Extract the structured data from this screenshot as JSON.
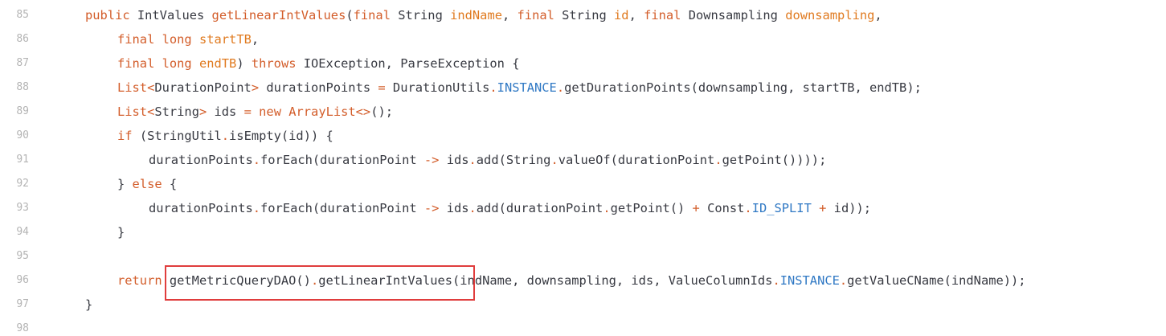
{
  "lines": [
    {
      "num": "85",
      "tokens": [
        {
          "t": "public",
          "c": "kw"
        },
        {
          "t": " IntValues ",
          "c": "tp"
        },
        {
          "t": "getLinearIntValues",
          "c": "fn"
        },
        {
          "t": "(",
          "c": "tp"
        },
        {
          "t": "final",
          "c": "kw"
        },
        {
          "t": " String ",
          "c": "tp"
        },
        {
          "t": "indName",
          "c": "pm"
        },
        {
          "t": ", ",
          "c": "tp"
        },
        {
          "t": "final",
          "c": "kw"
        },
        {
          "t": " String ",
          "c": "tp"
        },
        {
          "t": "id",
          "c": "pm"
        },
        {
          "t": ", ",
          "c": "tp"
        },
        {
          "t": "final",
          "c": "kw"
        },
        {
          "t": " Downsampling ",
          "c": "tp"
        },
        {
          "t": "downsampling",
          "c": "pm"
        },
        {
          "t": ",",
          "c": "tp"
        }
      ],
      "indent": 1
    },
    {
      "num": "86",
      "tokens": [
        {
          "t": "final",
          "c": "kw"
        },
        {
          "t": " ",
          "c": "tp"
        },
        {
          "t": "long",
          "c": "kw"
        },
        {
          "t": " ",
          "c": "tp"
        },
        {
          "t": "startTB",
          "c": "pm"
        },
        {
          "t": ",",
          "c": "tp"
        }
      ],
      "indent": 2
    },
    {
      "num": "87",
      "tokens": [
        {
          "t": "final",
          "c": "kw"
        },
        {
          "t": " ",
          "c": "tp"
        },
        {
          "t": "long",
          "c": "kw"
        },
        {
          "t": " ",
          "c": "tp"
        },
        {
          "t": "endTB",
          "c": "pm"
        },
        {
          "t": ") ",
          "c": "tp"
        },
        {
          "t": "throws",
          "c": "kw"
        },
        {
          "t": " IOException, ParseException {",
          "c": "tp"
        }
      ],
      "indent": 2
    },
    {
      "num": "88",
      "tokens": [
        {
          "t": "List",
          "c": "kw"
        },
        {
          "t": "<",
          "c": "op"
        },
        {
          "t": "DurationPoint",
          "c": "tp"
        },
        {
          "t": ">",
          "c": "op"
        },
        {
          "t": " durationPoints ",
          "c": "tp"
        },
        {
          "t": "=",
          "c": "op"
        },
        {
          "t": " DurationUtils",
          "c": "tp"
        },
        {
          "t": ".",
          "c": "op"
        },
        {
          "t": "INSTANCE",
          "c": "cn"
        },
        {
          "t": ".",
          "c": "op"
        },
        {
          "t": "getDurationPoints(downsampling, startTB, endTB);",
          "c": "tp"
        }
      ],
      "indent": 2
    },
    {
      "num": "89",
      "tokens": [
        {
          "t": "List",
          "c": "kw"
        },
        {
          "t": "<",
          "c": "op"
        },
        {
          "t": "String",
          "c": "tp"
        },
        {
          "t": ">",
          "c": "op"
        },
        {
          "t": " ids ",
          "c": "tp"
        },
        {
          "t": "=",
          "c": "op"
        },
        {
          "t": " ",
          "c": "tp"
        },
        {
          "t": "new",
          "c": "kw"
        },
        {
          "t": " ",
          "c": "tp"
        },
        {
          "t": "ArrayList",
          "c": "kw"
        },
        {
          "t": "<>",
          "c": "op"
        },
        {
          "t": "();",
          "c": "tp"
        }
      ],
      "indent": 2
    },
    {
      "num": "90",
      "tokens": [
        {
          "t": "if",
          "c": "kw"
        },
        {
          "t": " (StringUtil",
          "c": "tp"
        },
        {
          "t": ".",
          "c": "op"
        },
        {
          "t": "isEmpty(id)) {",
          "c": "tp"
        }
      ],
      "indent": 2
    },
    {
      "num": "91",
      "tokens": [
        {
          "t": "durationPoints",
          "c": "tp"
        },
        {
          "t": ".",
          "c": "op"
        },
        {
          "t": "forEach(durationPoint ",
          "c": "tp"
        },
        {
          "t": "->",
          "c": "op"
        },
        {
          "t": " ids",
          "c": "tp"
        },
        {
          "t": ".",
          "c": "op"
        },
        {
          "t": "add(String",
          "c": "tp"
        },
        {
          "t": ".",
          "c": "op"
        },
        {
          "t": "valueOf(durationPoint",
          "c": "tp"
        },
        {
          "t": ".",
          "c": "op"
        },
        {
          "t": "getPoint())));",
          "c": "tp"
        }
      ],
      "indent": 3
    },
    {
      "num": "92",
      "tokens": [
        {
          "t": "} ",
          "c": "tp"
        },
        {
          "t": "else",
          "c": "kw"
        },
        {
          "t": " {",
          "c": "tp"
        }
      ],
      "indent": 2
    },
    {
      "num": "93",
      "tokens": [
        {
          "t": "durationPoints",
          "c": "tp"
        },
        {
          "t": ".",
          "c": "op"
        },
        {
          "t": "forEach(durationPoint ",
          "c": "tp"
        },
        {
          "t": "->",
          "c": "op"
        },
        {
          "t": " ids",
          "c": "tp"
        },
        {
          "t": ".",
          "c": "op"
        },
        {
          "t": "add(durationPoint",
          "c": "tp"
        },
        {
          "t": ".",
          "c": "op"
        },
        {
          "t": "getPoint() ",
          "c": "tp"
        },
        {
          "t": "+",
          "c": "op"
        },
        {
          "t": " Const",
          "c": "tp"
        },
        {
          "t": ".",
          "c": "op"
        },
        {
          "t": "ID_SPLIT",
          "c": "cn"
        },
        {
          "t": " ",
          "c": "tp"
        },
        {
          "t": "+",
          "c": "op"
        },
        {
          "t": " id));",
          "c": "tp"
        }
      ],
      "indent": 3
    },
    {
      "num": "94",
      "tokens": [
        {
          "t": "}",
          "c": "tp"
        }
      ],
      "indent": 2
    },
    {
      "num": "95",
      "tokens": [],
      "indent": 0
    },
    {
      "num": "96",
      "tokens": [
        {
          "t": "return",
          "c": "kw"
        },
        {
          "t": " getMetricQueryDAO()",
          "c": "tp"
        },
        {
          "t": ".",
          "c": "op"
        },
        {
          "t": "getLinearIntValues",
          "c": "tp"
        },
        {
          "t": "(indName, downsampling, ids, ValueColumnIds",
          "c": "tp"
        },
        {
          "t": ".",
          "c": "op"
        },
        {
          "t": "INSTANCE",
          "c": "cn"
        },
        {
          "t": ".",
          "c": "op"
        },
        {
          "t": "getValueCName(indName));",
          "c": "tp"
        }
      ],
      "indent": 2
    },
    {
      "num": "97",
      "tokens": [
        {
          "t": "}",
          "c": "tp"
        }
      ],
      "indent": 1
    },
    {
      "num": "98",
      "tokens": [],
      "indent": 0
    }
  ],
  "colors": {
    "keyword": "#d35d2a",
    "param": "#e07a1f",
    "constant": "#2f78c4",
    "text": "#383a42",
    "line_number": "#b4b4b4",
    "highlight_border": "#e03d3d"
  }
}
